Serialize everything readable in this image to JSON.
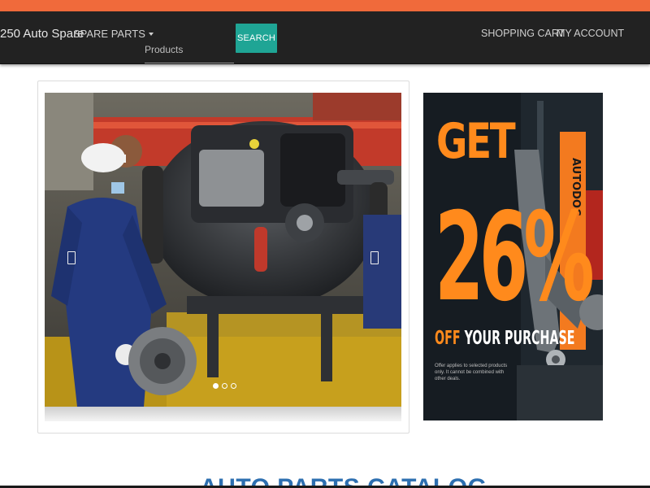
{
  "brand": {
    "name": "250 Auto Spare"
  },
  "nav": {
    "spare_parts_label": "SPARE PARTS",
    "search_placeholder": "Products",
    "search_button": "SEARCH",
    "shopping_cart": "SHOPPING CART",
    "my_account": "MY ACCOUNT"
  },
  "carousel": {
    "slide_count": 3,
    "active_index": 0
  },
  "promo": {
    "line1": "GET",
    "percent": "26%",
    "off": "OFF",
    "your_purchase": "YOUR PURCHASE",
    "fine_print": "Offer applies to selected products only. It cannot be combined with other deals.",
    "brand_box_text": "AUTODOC"
  },
  "section": {
    "title": "AUTO PARTS CATALOG"
  },
  "colors": {
    "top_strip": "#f06a3b",
    "navbar": "#222222",
    "search_button": "#1fa595",
    "promo_accent": "#ff8a1c",
    "section_title": "#2d6fb0"
  }
}
